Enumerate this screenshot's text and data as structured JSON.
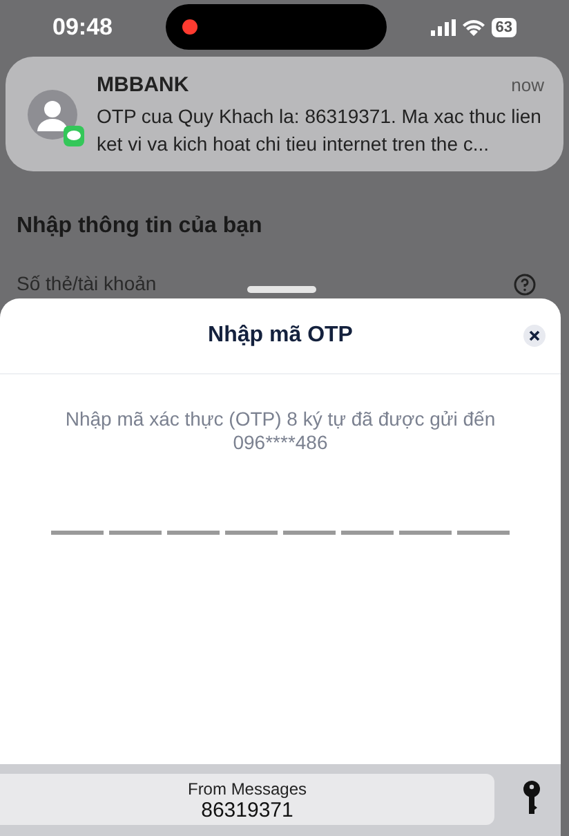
{
  "status_bar": {
    "time": "09:48",
    "recording": true,
    "battery": "63"
  },
  "notification": {
    "app": "MBBANK",
    "time": "now",
    "message": "OTP cua Quy Khach la: 86319371. Ma xac thuc lien ket vi va kich hoat chi tieu internet tren the c..."
  },
  "background": {
    "heading": "Nhập thông tin của bạn",
    "field_label": "Số thẻ/tài khoản"
  },
  "sheet": {
    "title": "Nhập mã OTP",
    "instruction": "Nhập mã xác thực (OTP) 8 ký tự đã được gửi đến 096****486",
    "otp_slots": [
      {
        "filled": false
      },
      {
        "filled": false
      },
      {
        "filled": false
      },
      {
        "filled": false
      },
      {
        "filled": false
      },
      {
        "filled": false
      },
      {
        "filled": false
      },
      {
        "filled": false
      }
    ]
  },
  "autofill": {
    "label": "From Messages",
    "code": "86319371"
  }
}
